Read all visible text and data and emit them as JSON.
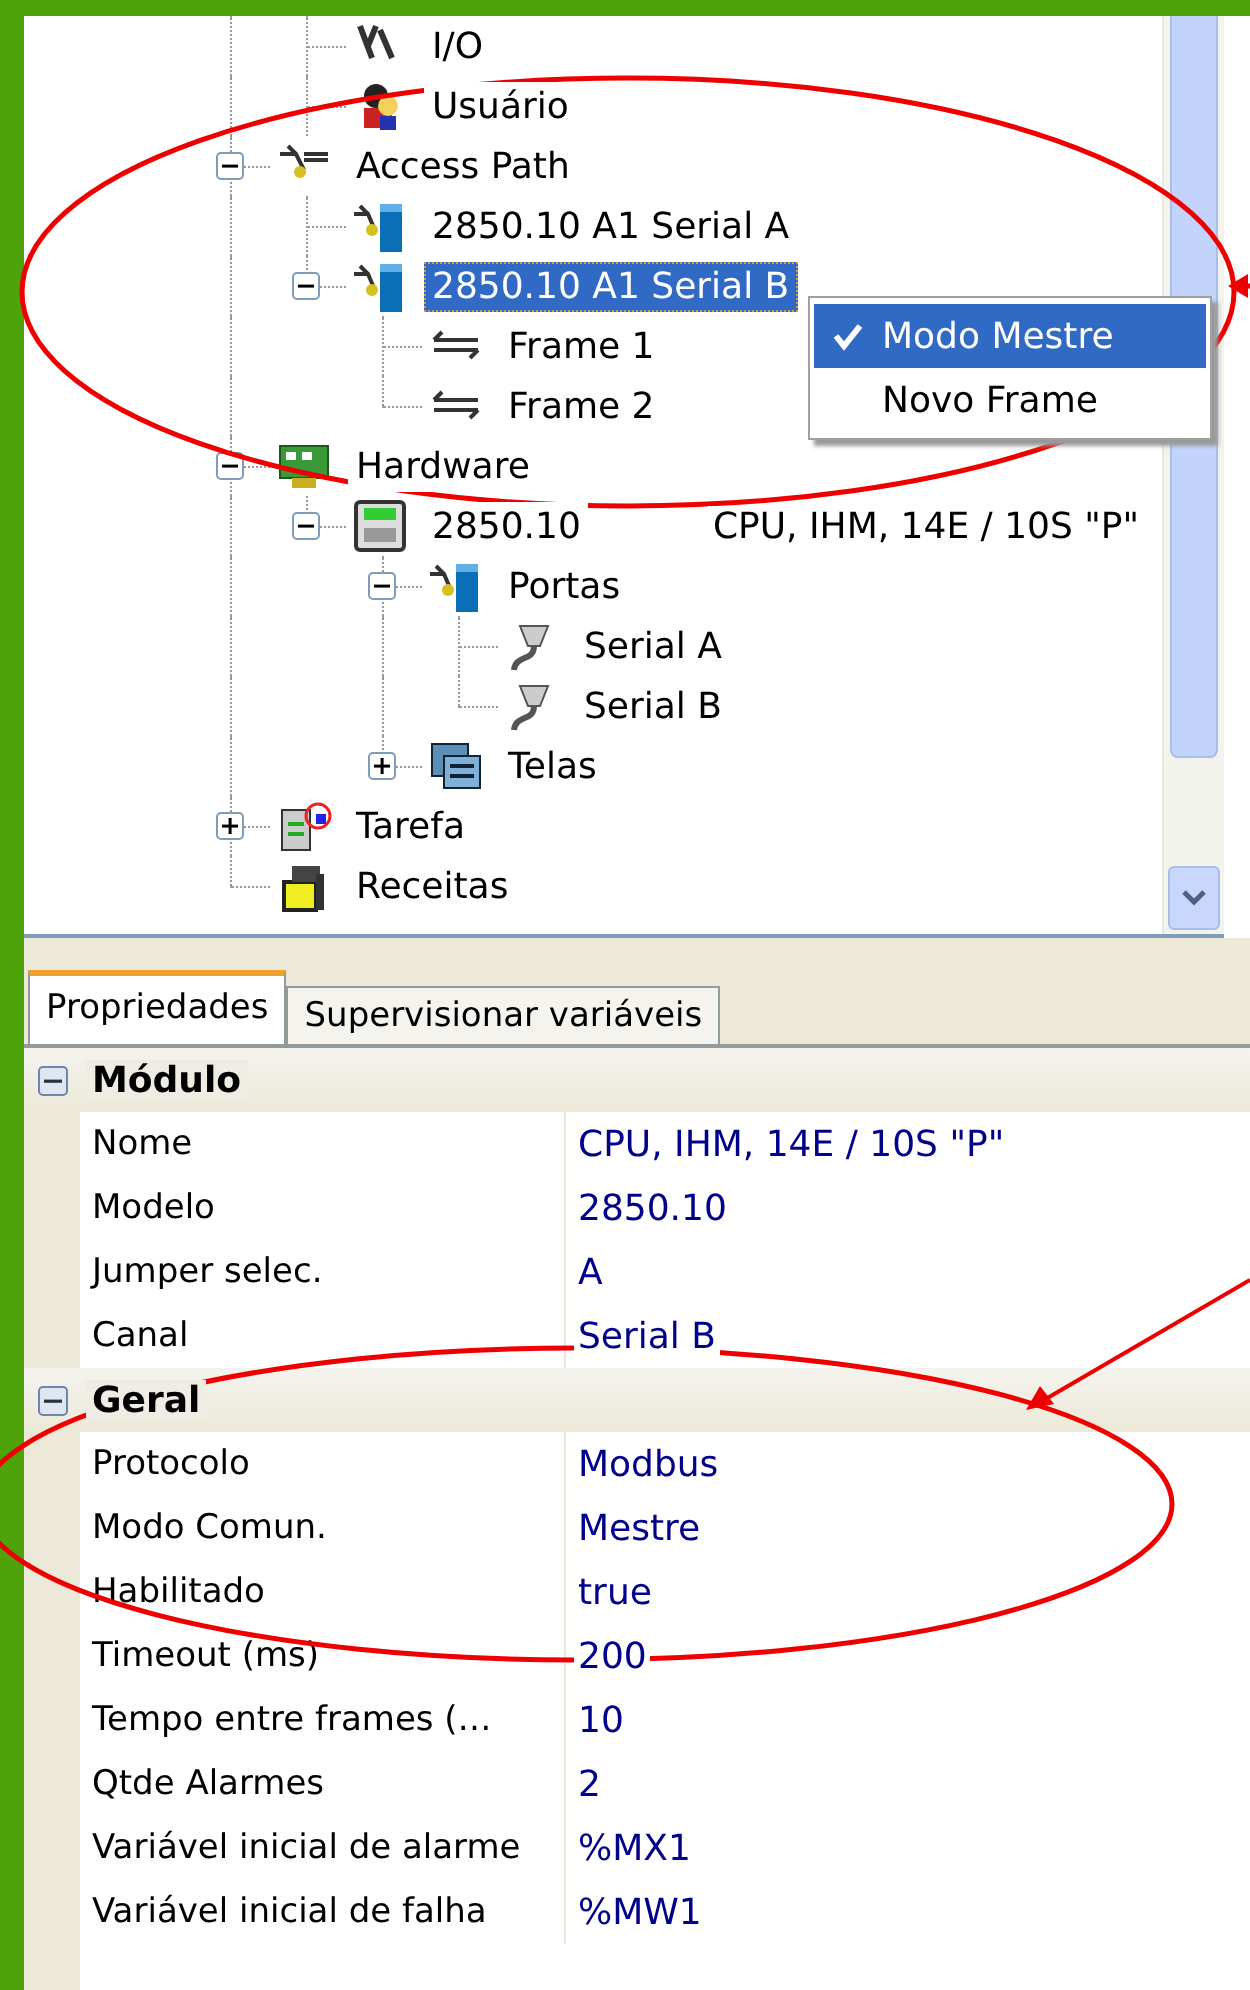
{
  "tree": {
    "partial_children": [
      {
        "label": "I/O",
        "kind": "io",
        "selected": false
      },
      {
        "label": "Usuário",
        "kind": "user",
        "selected": false
      }
    ],
    "items": [
      {
        "label": "Access Path",
        "kind": "path",
        "selected": false,
        "expanded": true,
        "children": [
          {
            "label": "2850.10 A1 Serial A",
            "kind": "port",
            "selected": false
          },
          {
            "label": "2850.10 A1 Serial B",
            "kind": "port",
            "selected": true,
            "expanded": true,
            "children": [
              {
                "label": "Frame 1",
                "kind": "frame",
                "selected": false
              },
              {
                "label": "Frame 2",
                "kind": "frame",
                "selected": false
              }
            ]
          }
        ]
      },
      {
        "label": "Hardware",
        "kind": "hardware",
        "selected": false,
        "expanded": true,
        "children": [
          {
            "label": "2850.10",
            "description": "CPU, IHM, 14E / 10S \"P\"",
            "kind": "cpu",
            "selected": false,
            "expanded": true,
            "children": [
              {
                "label": "Portas",
                "kind": "port",
                "selected": false,
                "expanded": true,
                "children": [
                  {
                    "label": "Serial A",
                    "kind": "serial",
                    "selected": false
                  },
                  {
                    "label": "Serial B",
                    "kind": "serial",
                    "selected": false
                  }
                ]
              },
              {
                "label": "Telas",
                "kind": "screens",
                "selected": false,
                "expanded": false
              }
            ]
          }
        ]
      },
      {
        "label": "Tarefa",
        "kind": "task",
        "selected": false,
        "expanded": false
      },
      {
        "label": "Receitas",
        "kind": "recipe",
        "selected": false
      }
    ]
  },
  "context_menu": [
    {
      "label": "Modo Mestre",
      "checked": true,
      "selected": true
    },
    {
      "label": "Novo Frame",
      "checked": false,
      "selected": false
    }
  ],
  "tabs": [
    {
      "label": "Propriedades",
      "selected": true
    },
    {
      "label": "Supervisionar variáveis",
      "selected": false
    }
  ],
  "properties": [
    {
      "category": "Módulo",
      "expanded": true,
      "rows": [
        {
          "name": "Nome",
          "value": "CPU, IHM, 14E / 10S \"P\""
        },
        {
          "name": "Modelo",
          "value": "2850.10"
        },
        {
          "name": "Jumper selec.",
          "value": "A"
        },
        {
          "name": "Canal",
          "value": "Serial B"
        }
      ]
    },
    {
      "category": "Geral",
      "expanded": true,
      "rows": [
        {
          "name": "Protocolo",
          "value": "Modbus"
        },
        {
          "name": "Modo Comun.",
          "value": "Mestre"
        },
        {
          "name": "Habilitado",
          "value": "true"
        },
        {
          "name": "Timeout (ms)",
          "value": "200"
        },
        {
          "name": "Tempo entre frames (…",
          "value": "10"
        },
        {
          "name": "Qtde Alarmes",
          "value": "2"
        },
        {
          "name": "Variável inicial de alarme",
          "value": "%MX1"
        },
        {
          "name": "Variável inicial de falha",
          "value": "%MW1"
        }
      ]
    }
  ]
}
